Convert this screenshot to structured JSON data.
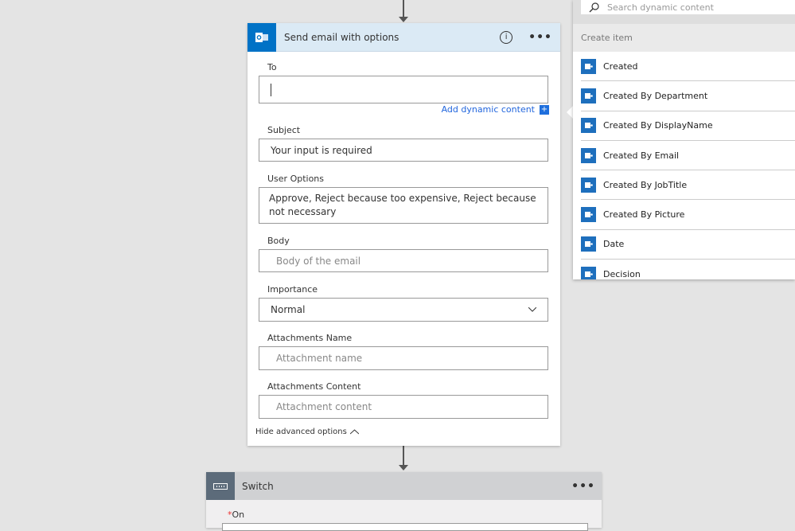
{
  "email_card": {
    "title": "Send email with options",
    "info_icon": "info-icon",
    "menu": "•••",
    "to": {
      "label": "To",
      "value": ""
    },
    "add_dynamic": "Add dynamic content",
    "add_dynamic_plus": "+",
    "subject": {
      "label": "Subject",
      "value": "Your input is required"
    },
    "user_options": {
      "label": "User Options",
      "value": "Approve, Reject because too expensive, Reject because not necessary"
    },
    "body": {
      "label": "Body",
      "placeholder": "Body of the email"
    },
    "importance": {
      "label": "Importance",
      "value": "Normal"
    },
    "attachments_name": {
      "label": "Attachments Name",
      "placeholder": "Attachment name"
    },
    "attachments_content": {
      "label": "Attachments Content",
      "placeholder": "Attachment content"
    },
    "hide_advanced": "Hide advanced options"
  },
  "dynamic_panel": {
    "search_placeholder": "Search dynamic content",
    "section": "Create item",
    "items": [
      "Created",
      "Created By Department",
      "Created By DisplayName",
      "Created By Email",
      "Created By JobTitle",
      "Created By Picture",
      "Date",
      "Decision"
    ]
  },
  "switch_card": {
    "title": "Switch",
    "menu": "•••",
    "on_label": "On",
    "required_mark": "*"
  },
  "colors": {
    "outlook_blue": "#0072c6",
    "header_blue": "#dbeaf5",
    "switch_icon": "#5c6b7a",
    "link": "#2266dd"
  }
}
